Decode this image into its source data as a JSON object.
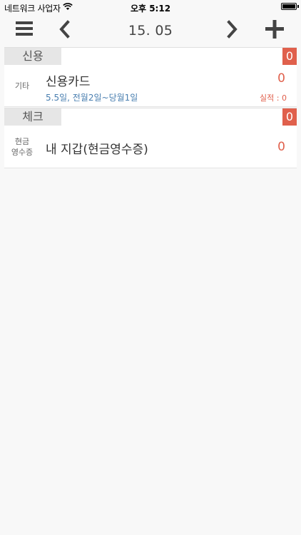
{
  "status_bar": {
    "carrier": "네트워크 사업자",
    "time": "오후 5:12",
    "wifi_icon": "wifi-icon",
    "battery_icon": "battery-icon"
  },
  "nav": {
    "title": "15. 05",
    "menu_icon": "hamburger-menu-icon",
    "prev_icon": "chevron-left-icon",
    "next_icon": "chevron-right-icon",
    "add_icon": "plus-icon"
  },
  "sections": [
    {
      "label": "신용",
      "total": "0",
      "rows": [
        {
          "type": "기타",
          "name": "신용카드",
          "amount": "0",
          "billing_info": "5.5일, 전월2일~당월1일",
          "performance": "실적 : 0"
        }
      ]
    },
    {
      "label": "체크",
      "total": "0",
      "rows": [
        {
          "type_line1": "현금",
          "type_line2": "영수증",
          "name": "내 지갑(현금영수증)",
          "amount": "0"
        }
      ]
    }
  ],
  "colors": {
    "accent": "#e0604c",
    "link": "#4a7fb0",
    "background": "#f8f8f8"
  }
}
